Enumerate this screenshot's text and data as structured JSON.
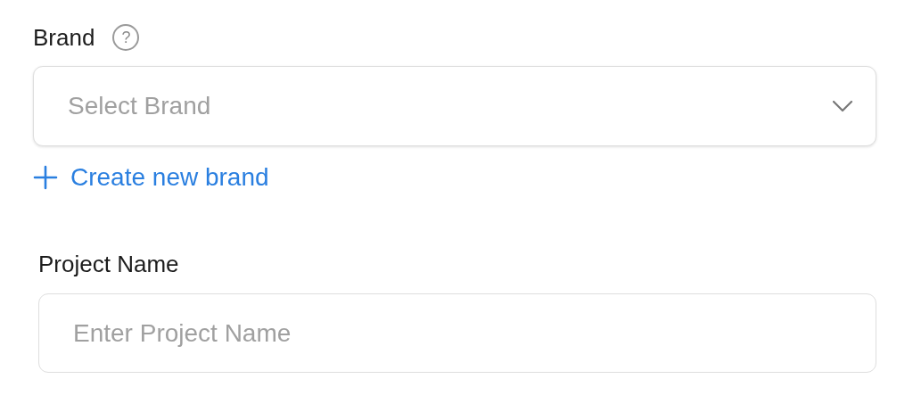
{
  "brand": {
    "label": "Brand",
    "help_icon": "?",
    "select": {
      "placeholder": "Select Brand"
    },
    "create_link": {
      "label": "Create new brand"
    }
  },
  "project_name": {
    "label": "Project Name",
    "input": {
      "placeholder": "Enter Project Name"
    }
  }
}
